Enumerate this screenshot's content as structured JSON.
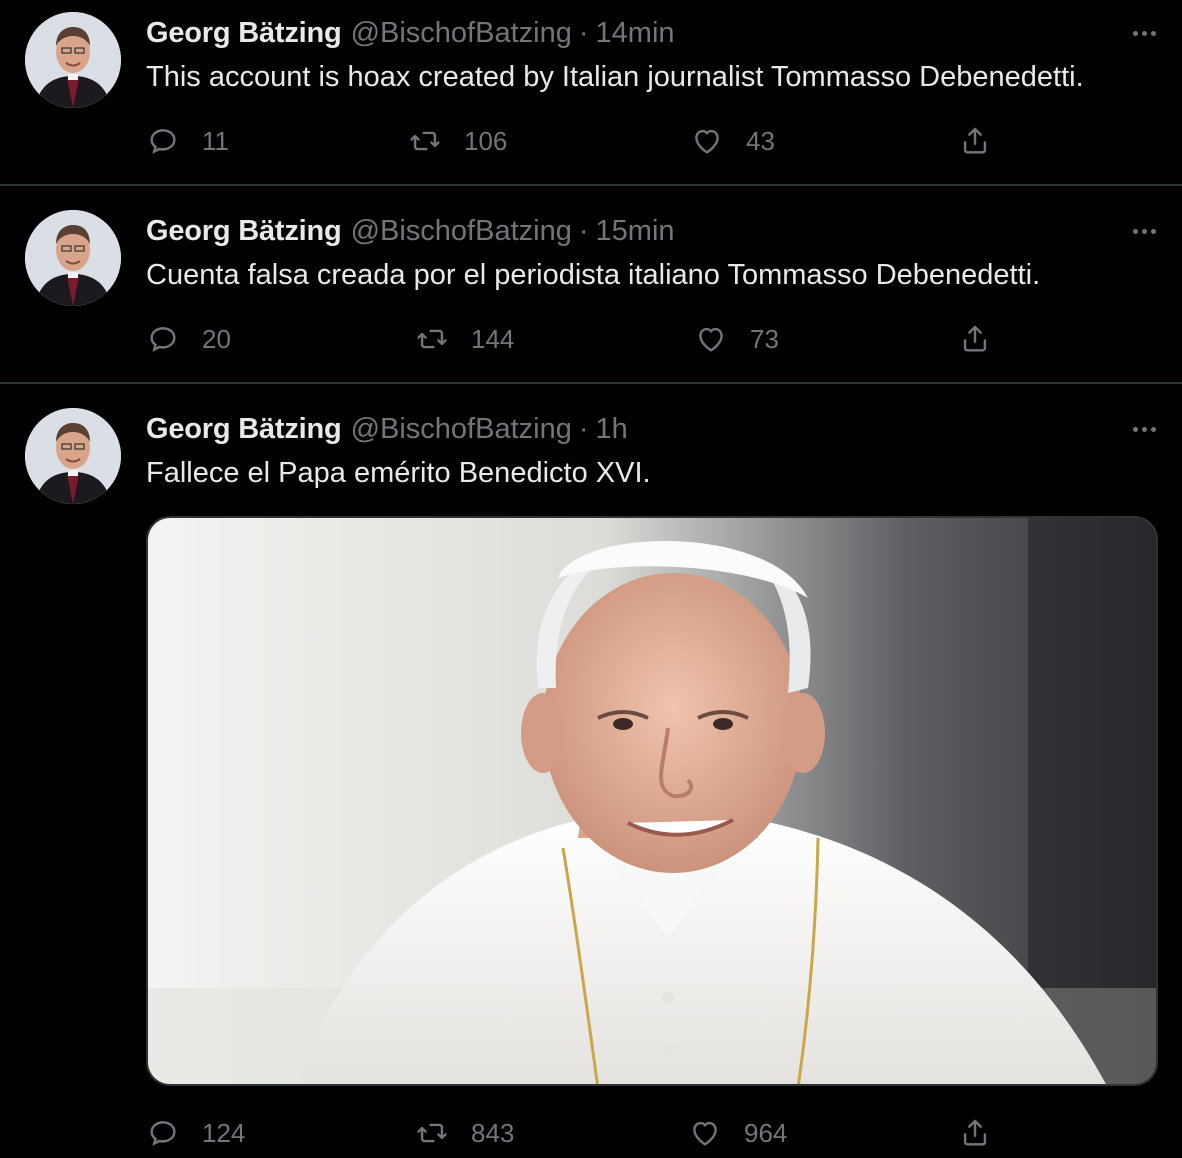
{
  "tweets": [
    {
      "author_name": "Georg Bätzing",
      "author_handle": "@BischofBatzing",
      "separator": "·",
      "time": "14min",
      "text": "This account is hoax created by Italian journalist Tommasso Debenedetti.",
      "replies": "11",
      "retweets": "106",
      "likes": "43"
    },
    {
      "author_name": "Georg Bätzing",
      "author_handle": "@BischofBatzing",
      "separator": "·",
      "time": "15min",
      "text": "Cuenta falsa creada por el periodista italiano Tommasso Debenedetti.",
      "replies": "20",
      "retweets": "144",
      "likes": "73"
    },
    {
      "author_name": "Georg Bätzing",
      "author_handle": "@BischofBatzing",
      "separator": "·",
      "time": "1h",
      "text": "Fallece el Papa emérito Benedicto XVI.",
      "replies": "124",
      "retweets": "843",
      "likes": "964",
      "media": "photo"
    }
  ],
  "icons": {
    "reply": "reply-icon",
    "retweet": "retweet-icon",
    "like": "heart-icon",
    "share": "share-icon",
    "more": "more-icon"
  },
  "colors": {
    "background": "#000000",
    "text_primary": "#e7e9ea",
    "text_secondary": "#71767b",
    "divider": "#2f3336"
  }
}
